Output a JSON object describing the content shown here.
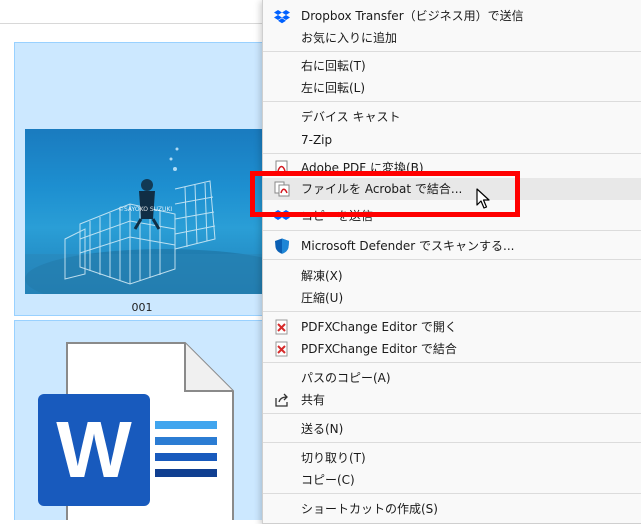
{
  "files": [
    {
      "name": "001",
      "thumbnail": "underwater-diver-cage-photo",
      "watermark": "©SAYOKO SUZUKI"
    },
    {
      "name": "",
      "icon": "word-document-icon",
      "letter": "W"
    }
  ],
  "context_menu": {
    "items": [
      {
        "id": "dropbox",
        "label": "Dropbox Transfer（ビジネス用）で送信",
        "icon": "dropbox-icon"
      },
      {
        "id": "fav",
        "label": "お気に入りに追加"
      },
      {
        "id": "rotr",
        "label": "右に回転(T)"
      },
      {
        "id": "rotl",
        "label": "左に回転(L)"
      },
      {
        "id": "cast",
        "label": "デバイス キャスト"
      },
      {
        "id": "zip",
        "label": "7-Zip"
      },
      {
        "id": "pdfconv",
        "label": "Adobe PDF に変換(B)",
        "icon": "acrobat-icon"
      },
      {
        "id": "combine",
        "label": "ファイルを Acrobat で結合...",
        "icon": "acrobat-combine-icon",
        "highlighted": true
      },
      {
        "id": "sendto",
        "label": "コピーを送信",
        "icon": "dropbox-icon"
      },
      {
        "id": "defender",
        "label": "Microsoft Defender でスキャンする...",
        "icon": "defender-shield-icon"
      },
      {
        "id": "extract",
        "label": "解凍(X)"
      },
      {
        "id": "compress",
        "label": "圧縮(U)"
      },
      {
        "id": "pdfxopen",
        "label": "PDFXChange Editor で開く",
        "icon": "pdfxchange-icon"
      },
      {
        "id": "pdfxcomb",
        "label": "PDFXChange Editor で結合",
        "icon": "pdfxchange-icon"
      },
      {
        "id": "copypath",
        "label": "パスのコピー(A)"
      },
      {
        "id": "share",
        "label": "共有",
        "icon": "share-icon"
      },
      {
        "id": "send",
        "label": "送る(N)"
      },
      {
        "id": "cut",
        "label": "切り取り(T)"
      },
      {
        "id": "copy",
        "label": "コピー(C)"
      },
      {
        "id": "shortcut",
        "label": "ショートカットの作成(S)"
      }
    ]
  },
  "colors": {
    "selection_bg": "#cce8ff",
    "selection_border": "#99d1ff",
    "annotation_red": "#ff0000",
    "dropbox_blue": "#0061ff",
    "word_blue": "#185abd"
  }
}
